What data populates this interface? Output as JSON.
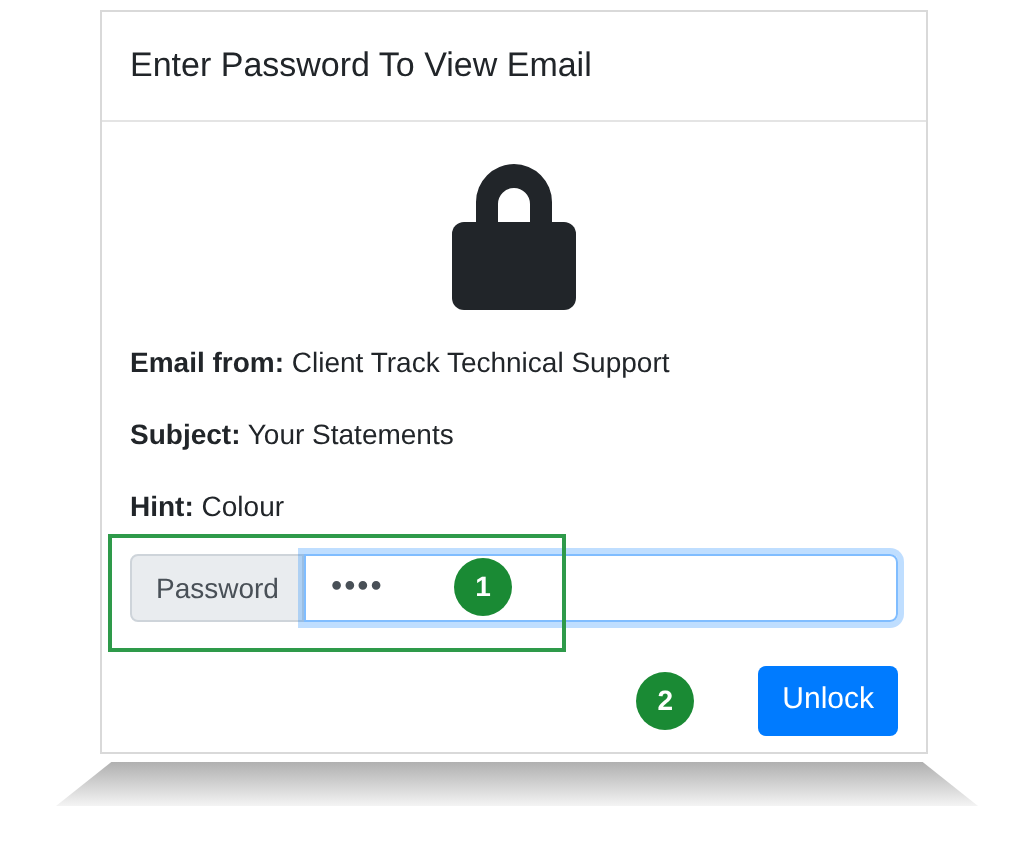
{
  "dialog": {
    "title": "Enter Password To View Email",
    "details": [
      "**Email from:** Client Track Technical Support",
      "**Subject:** Your Statements",
      "**Hint:** Colour"
    ],
    "password": {
      "label": "Password",
      "value": "••••",
      "focused": true
    },
    "callouts": [
      "1",
      "2"
    ],
    "unlock_button": "Unlock"
  }
}
